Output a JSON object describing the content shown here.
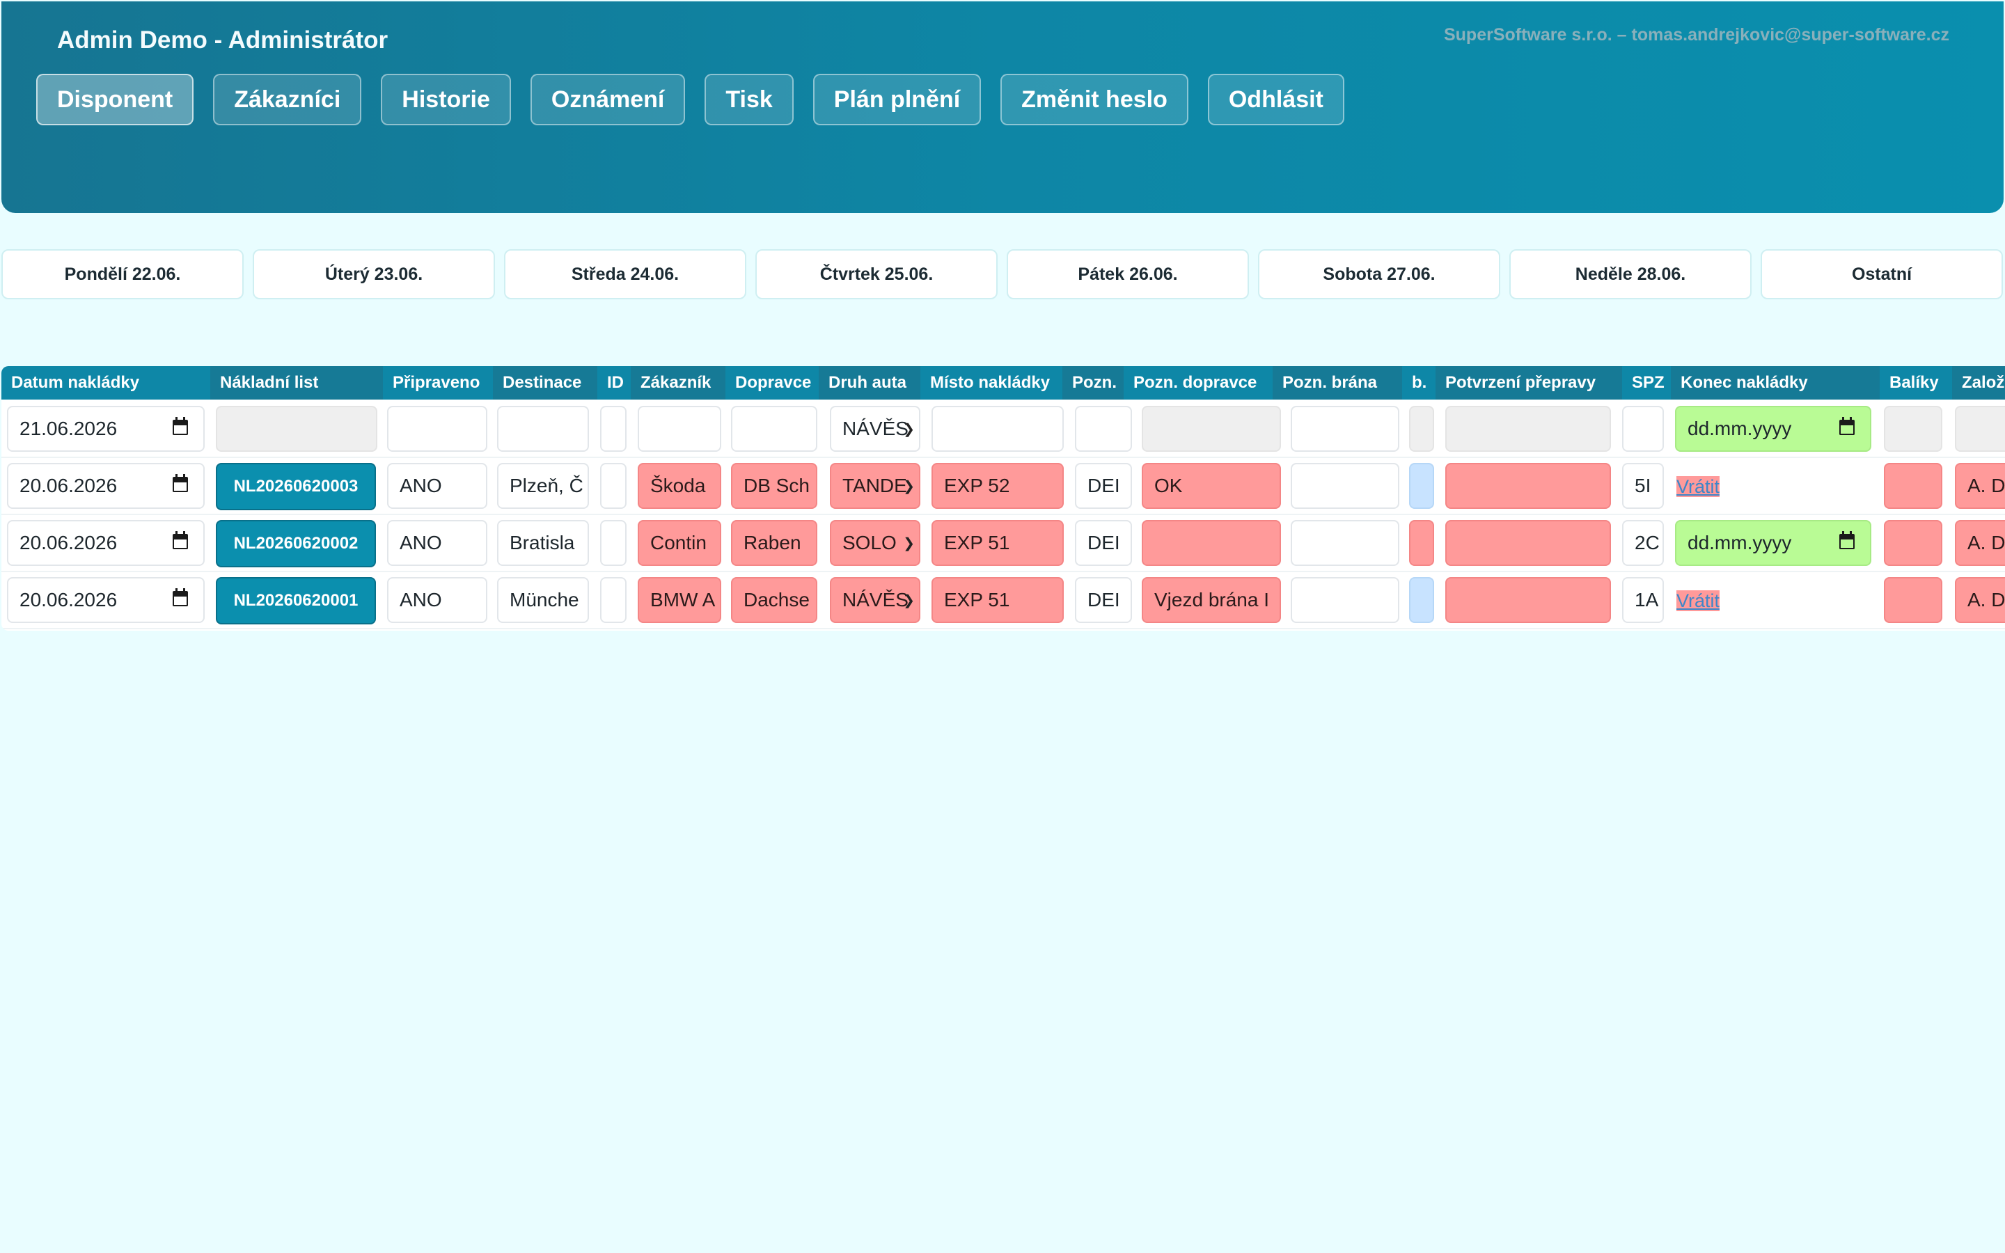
{
  "header": {
    "title": "Admin Demo - Administrátor",
    "company": "SuperSoftware s.r.o. – tomas.andrejkovic@super-software.cz",
    "nav": [
      "Disponent",
      "Zákazníci",
      "Historie",
      "Oznámení",
      "Tisk",
      "Plán plnění",
      "Změnit heslo",
      "Odhlásit"
    ],
    "active_nav": "Disponent"
  },
  "days": [
    "Pondělí 22.06.",
    "Úterý 23.06.",
    "Středa 24.06.",
    "Čtvrtek 25.06.",
    "Pátek 26.06.",
    "Sobota 27.06.",
    "Neděle 28.06.",
    "Ostatní"
  ],
  "table": {
    "columns": [
      "Datum nakládky",
      "Nákladní list",
      "Připraveno",
      "Destinace",
      "ID",
      "Zákazník",
      "Dopravce",
      "Druh auta",
      "Místo nakládky",
      "Pozn.",
      "Pozn. dopravce",
      "Pozn. brána",
      "b.",
      "Potvrzení přepravy",
      "SPZ",
      "Konec nakládky",
      "Balíky",
      "Založ"
    ],
    "filter_row": {
      "date": "21.06.2026",
      "vehicle": "NÁVĚS",
      "end_placeholder": "dd.mm.yyyy"
    },
    "rows": [
      {
        "date": "20.06.2026",
        "nl": "NL20260620003",
        "ready": "ANO",
        "dest": "Plzeň, Č",
        "id": "",
        "customer": "Škoda",
        "carrier": "DB Sch",
        "vehicle": "TANDE",
        "place": "EXP 52",
        "note": "DEI",
        "carrier_note": "OK",
        "gate_note": "",
        "confirm": "",
        "spz": "5I",
        "end": "Vrátit",
        "founder": "A. D"
      },
      {
        "date": "20.06.2026",
        "nl": "NL20260620002",
        "ready": "ANO",
        "dest": "Bratisla",
        "id": "",
        "customer": "Contin",
        "carrier": "Raben",
        "vehicle": "SOLO",
        "place": "EXP 51",
        "note": "DEI",
        "carrier_note": "",
        "gate_note": "",
        "confirm": "",
        "spz": "2C",
        "end": "dd.mm.yyyy",
        "founder": "A. D"
      },
      {
        "date": "20.06.2026",
        "nl": "NL20260620001",
        "ready": "ANO",
        "dest": "Münche",
        "id": "",
        "customer": "BMW A",
        "carrier": "Dachse",
        "vehicle": "NÁVĚS",
        "place": "EXP 51",
        "note": "DEI",
        "carrier_note": "Vjezd brána I",
        "gate_note": "",
        "confirm": "",
        "spz": "1A",
        "end": "Vrátit",
        "founder": "A. D"
      }
    ]
  },
  "colors": {
    "header_bg": "#0e86a5",
    "page_bg": "#e9fdff",
    "red_cell": "#ff9a9a",
    "green_cell": "#b9fb95",
    "blue_cell": "#c8e3ff",
    "nl_button": "#0b8fae"
  }
}
